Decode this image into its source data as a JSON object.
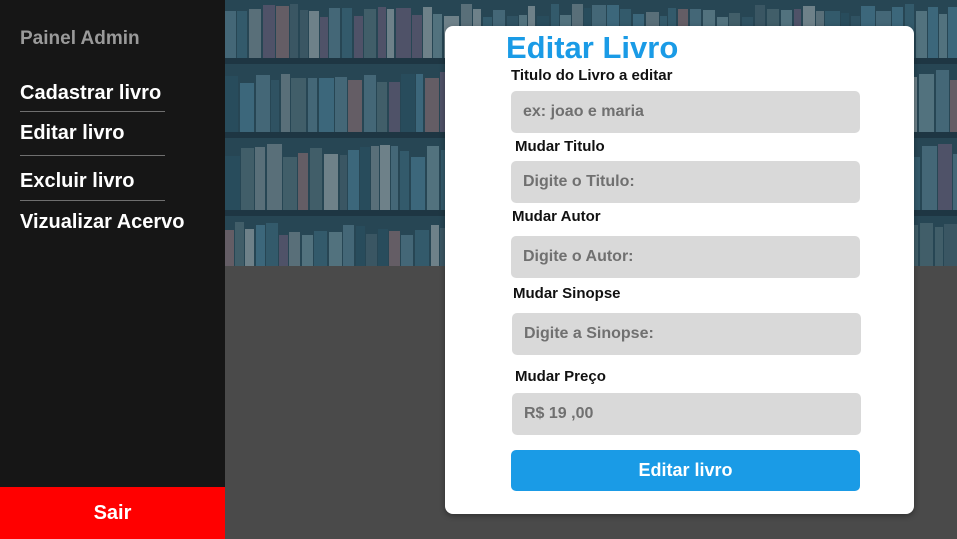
{
  "sidebar": {
    "brand": "Painel Admin",
    "items": [
      {
        "label": "Cadastrar livro"
      },
      {
        "label": "Editar livro"
      },
      {
        "label": "Excluir livro"
      },
      {
        "label": "Vizualizar Acervo"
      }
    ],
    "logout_label": "Sair"
  },
  "form": {
    "title": "Editar Livro",
    "fields": [
      {
        "label": "Titulo do Livro a editar",
        "placeholder": "ex: joao e maria",
        "value": ""
      },
      {
        "label": "Mudar Titulo",
        "placeholder": "Digite o Titulo:",
        "value": ""
      },
      {
        "label": "Mudar Autor",
        "placeholder": "Digite o Autor:",
        "value": ""
      },
      {
        "label": "Mudar Sinopse",
        "placeholder": "Digite a Sinopse:",
        "value": ""
      },
      {
        "label": "Mudar Preço",
        "placeholder": "R$ 19 ,00",
        "value": ""
      }
    ],
    "submit_label": "Editar livro"
  },
  "colors": {
    "accent": "#1a9be6",
    "danger": "#ff0000",
    "sidebar_bg": "#161616",
    "field_bg": "#d9d9d9"
  },
  "hero": {
    "icon": "bookshelf-image"
  }
}
